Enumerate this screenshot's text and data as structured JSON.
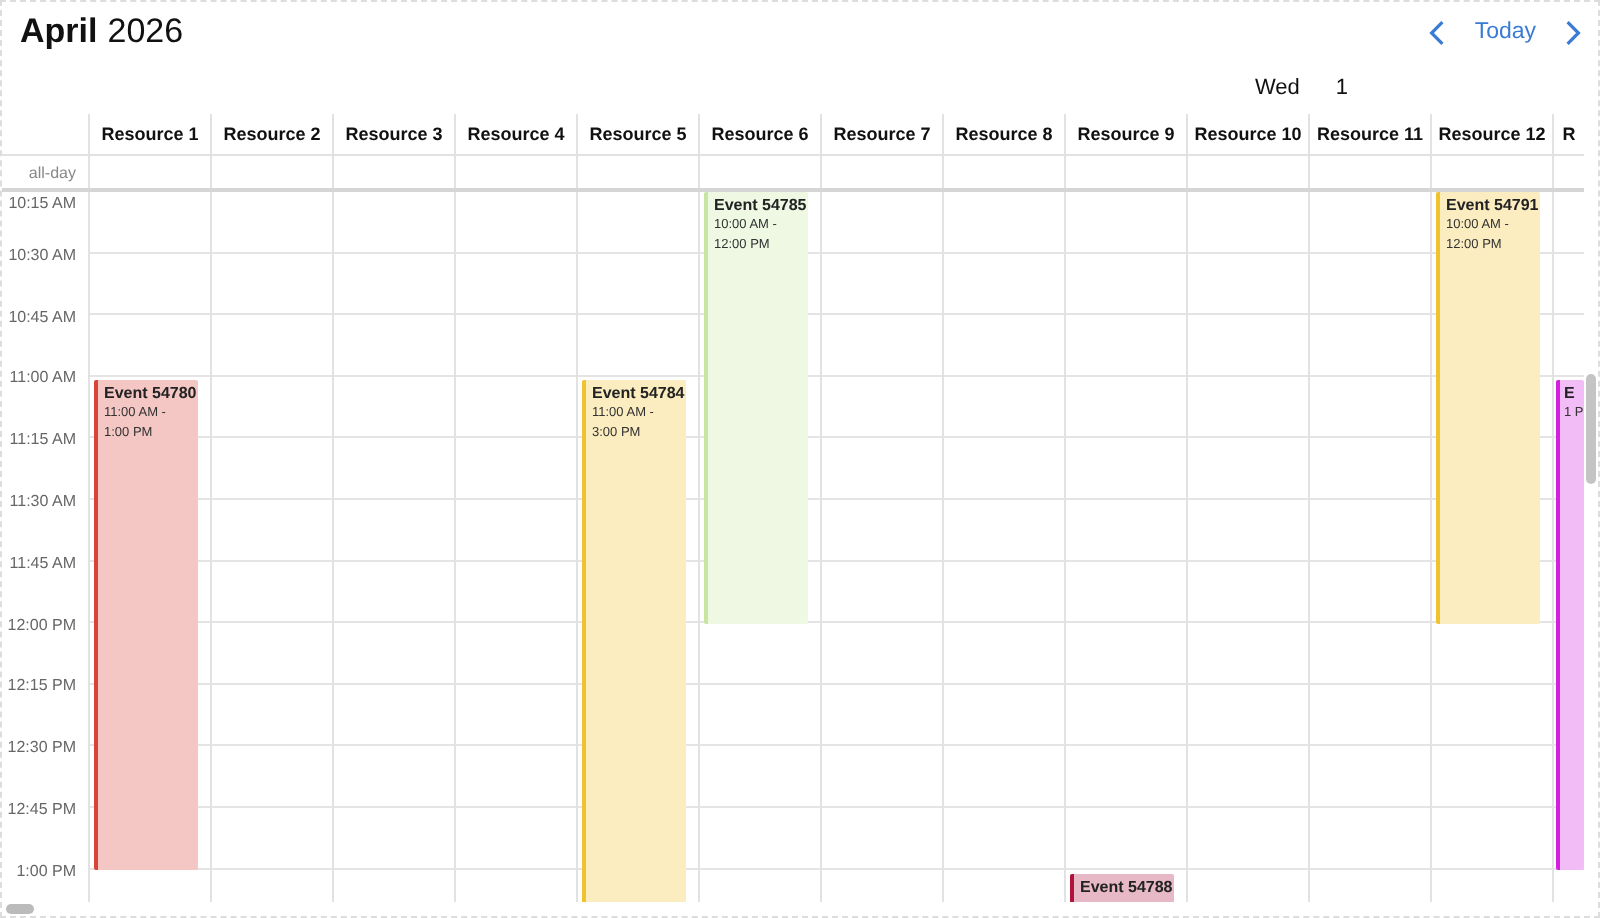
{
  "header": {
    "month": "April",
    "year": "2026",
    "today": "Today"
  },
  "day": {
    "weekday": "Wed",
    "date": "1"
  },
  "allday_label": "all-day",
  "times": [
    "10:15 AM",
    "10:30 AM",
    "10:45 AM",
    "11:00 AM",
    "11:15 AM",
    "11:30 AM",
    "11:45 AM",
    "12:00 PM",
    "12:15 PM",
    "12:30 PM",
    "12:45 PM",
    "1:00 PM"
  ],
  "resources": [
    {
      "name": "Resource 1",
      "events": [
        {
          "title": "Event 54780",
          "time": "11:00 AM - 1:00 PM",
          "color": "#d9443a"
        }
      ]
    },
    {
      "name": "Resource 2"
    },
    {
      "name": "Resource 3"
    },
    {
      "name": "Resource 4"
    },
    {
      "name": "Resource 5",
      "events": [
        {
          "title": "Event 54784",
          "time": "11:00 AM - 3:00 PM",
          "color": "#f0c22e"
        }
      ]
    },
    {
      "name": "Resource 6",
      "events": [
        {
          "title": "Event 54785",
          "time": "10:00 AM - 12:00 PM",
          "color": "#c6e6a2"
        }
      ]
    },
    {
      "name": "Resource 7"
    },
    {
      "name": "Resource 8"
    },
    {
      "name": "Resource 9",
      "events": [
        {
          "title": "Event 54788",
          "color": "#b0123c"
        }
      ]
    },
    {
      "name": "Resource 10"
    },
    {
      "name": "Resource 11"
    },
    {
      "name": "Resource 12",
      "events": [
        {
          "title": "Event 54791",
          "time": "10:00 AM - 12:00 PM",
          "color": "#f0c22e"
        }
      ]
    },
    {
      "name": "R",
      "events": [
        {
          "title": "E",
          "time": "1 P",
          "color": "#d41ee0"
        }
      ]
    }
  ]
}
